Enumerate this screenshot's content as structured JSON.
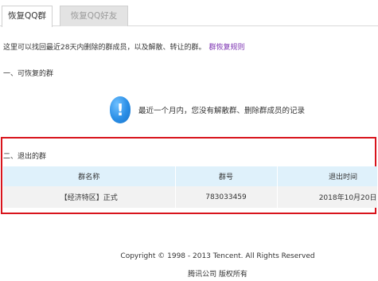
{
  "tabs": [
    {
      "label": "恢复QQ群",
      "active": true
    },
    {
      "label": "恢复QQ好友",
      "active": false
    }
  ],
  "intro": {
    "text": "这里可以找回最近28天内删除的群成员，以及解散、转让的群。",
    "link": "群恢复规则"
  },
  "section1": {
    "title": "一、可恢复的群"
  },
  "notice": {
    "icon": "info-icon",
    "text": "最近一个月内，您没有解散群、删除群成员的记录"
  },
  "section2": {
    "title": "二、退出的群"
  },
  "table": {
    "headers": [
      "群名称",
      "群号",
      "退出时间"
    ],
    "rows": [
      [
        "【经济特区】正式",
        "783033459",
        "2018年10月20日"
      ]
    ]
  },
  "footer": {
    "copyright": "Copyright © 1998 - 2013 Tencent. All Rights Reserved",
    "company": "腾讯公司 版权所有"
  },
  "colors": {
    "highlight_border": "#d8141c",
    "table_header_bg": "#dff1fb",
    "link": "#7a2fb0",
    "info_icon": "#2a8ee6"
  }
}
